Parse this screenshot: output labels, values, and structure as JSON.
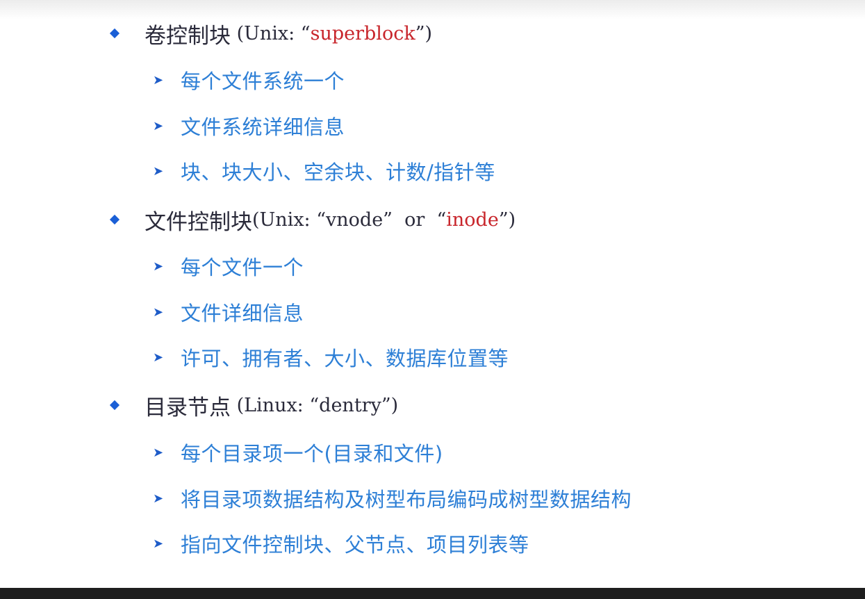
{
  "sections": [
    {
      "head_cjk": "卷控制块",
      "head_prefix": " (Unix: “",
      "head_highlight": "superblock",
      "head_middle": "",
      "head_highlight2": "",
      "head_suffix": "”)",
      "items": [
        "每个文件系统一个",
        "文件系统详细信息",
        "块、块大小、空余块、计数/指针等"
      ]
    },
    {
      "head_cjk": "文件控制块",
      "head_prefix": "(Unix: “vnode”  or  “",
      "head_highlight": "inode",
      "head_middle": "",
      "head_highlight2": "",
      "head_suffix": "”)",
      "items": [
        "每个文件一个",
        "文件详细信息",
        "许可、拥有者、大小、数据库位置等"
      ]
    },
    {
      "head_cjk": "目录节点",
      "head_prefix": " (Linux: “dentry”)",
      "head_highlight": "",
      "head_middle": "",
      "head_highlight2": "",
      "head_suffix": "",
      "items": [
        "每个目录项一个(目录和文件)",
        "将目录项数据结构及树型布局编码成树型数据结构",
        "指向文件控制块、父节点、项目列表等"
      ]
    }
  ],
  "colors": {
    "bullet": "#1a5fd6",
    "heading": "#2a2a3a",
    "highlight": "#c8252b",
    "subitem": "#2d7fd6"
  },
  "icons": {
    "level1_bullet": "diamond-bullet-icon",
    "level2_bullet": "chevron-right-icon"
  }
}
